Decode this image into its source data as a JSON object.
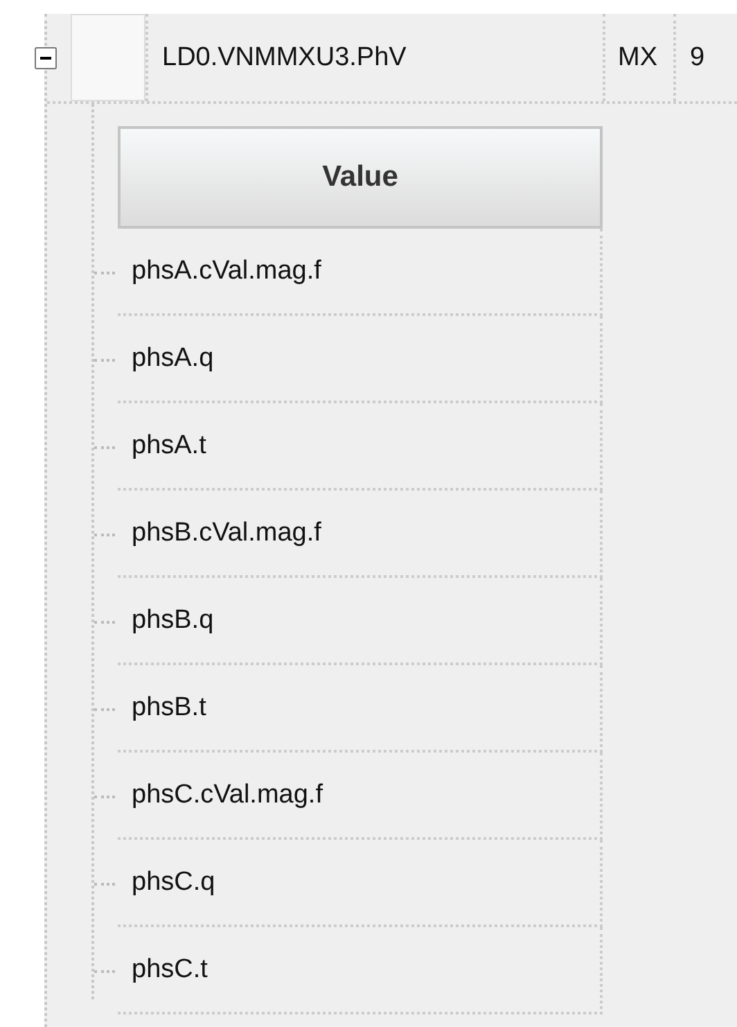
{
  "node": {
    "expanded": true,
    "name": "LD0.VNMMXU3.PhV",
    "fc": "MX",
    "column_4": "9"
  },
  "subtable": {
    "header": "Value",
    "rows": [
      "phsA.cVal.mag.f",
      "phsA.q",
      "phsA.t",
      "phsB.cVal.mag.f",
      "phsB.q",
      "phsB.t",
      "phsC.cVal.mag.f",
      "phsC.q",
      "phsC.t"
    ]
  }
}
